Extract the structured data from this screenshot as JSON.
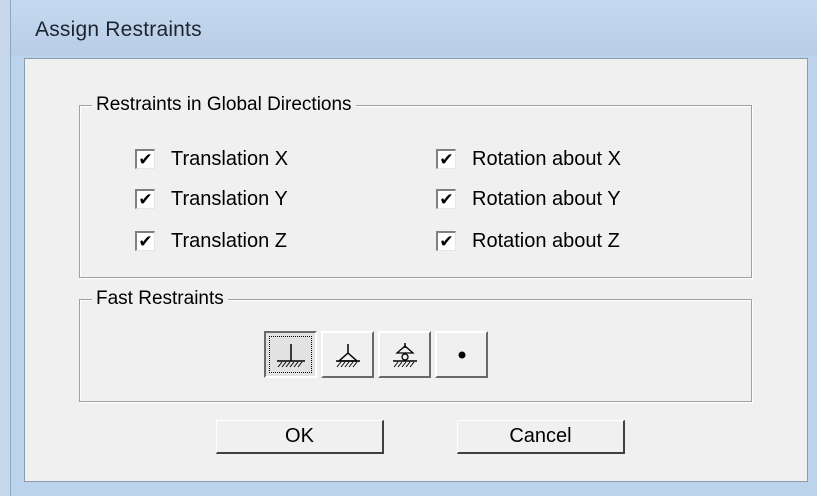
{
  "window": {
    "title": "Assign Restraints"
  },
  "restraints_group": {
    "title": "Restraints in Global Directions",
    "items": [
      {
        "label": "Translation X",
        "checked": true
      },
      {
        "label": "Translation Y",
        "checked": true
      },
      {
        "label": "Translation Z",
        "checked": true
      },
      {
        "label": "Rotation about X",
        "checked": true
      },
      {
        "label": "Rotation about Y",
        "checked": true
      },
      {
        "label": "Rotation about Z",
        "checked": true
      }
    ],
    "check_glyph": "✔"
  },
  "fast_restraints_group": {
    "title": "Fast Restraints",
    "buttons": [
      {
        "icon": "fixed-support-icon",
        "pressed": true
      },
      {
        "icon": "pinned-support-icon",
        "pressed": false
      },
      {
        "icon": "roller-support-icon",
        "pressed": false
      },
      {
        "icon": "free-node-icon",
        "pressed": false
      }
    ]
  },
  "buttons": {
    "ok_label": "OK",
    "cancel_label": "Cancel"
  },
  "colors": {
    "title_bar": "#bcd3ec",
    "dialog_face": "#f0f0f0"
  }
}
